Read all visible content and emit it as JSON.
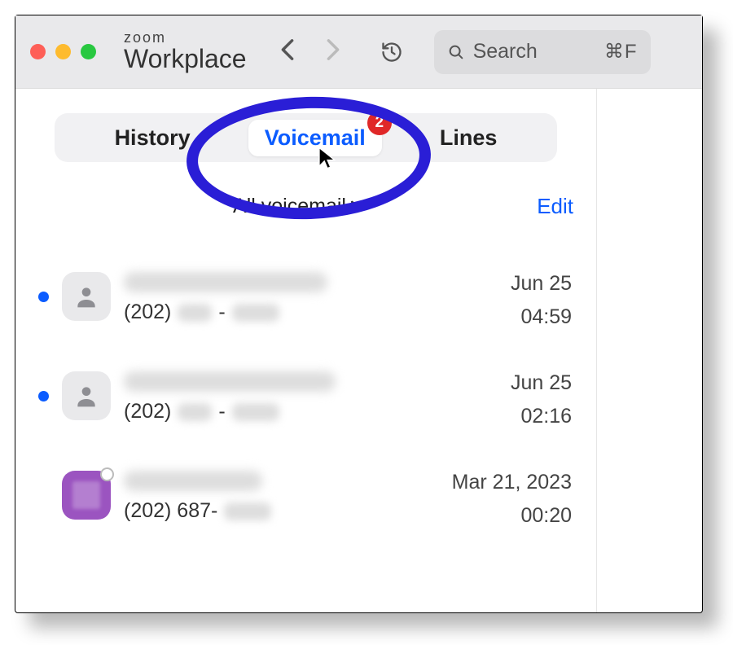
{
  "brand": {
    "line1": "zoom",
    "line2": "Workplace"
  },
  "search": {
    "placeholder": "Search",
    "shortcut": "⌘F"
  },
  "tabs": [
    {
      "label": "History",
      "active": false
    },
    {
      "label": "Voicemail",
      "active": true,
      "badge": "2"
    },
    {
      "label": "Lines",
      "active": false
    }
  ],
  "filter": {
    "label": "All voicemail",
    "edit": "Edit"
  },
  "voicemails": [
    {
      "unread": true,
      "avatar": "generic",
      "name_redacted": true,
      "name_blur_width": 250,
      "phone_prefix": "(202)",
      "phone_mid_redacted": true,
      "phone_last_redacted": true,
      "date": "Jun 25",
      "duration": "04:59"
    },
    {
      "unread": true,
      "avatar": "generic",
      "name_redacted": true,
      "name_blur_width": 260,
      "phone_prefix": "(202)",
      "phone_mid_redacted": true,
      "phone_last_redacted": true,
      "date": "Jun 25",
      "duration": "02:16"
    },
    {
      "unread": false,
      "avatar": "purple",
      "presence": "offline",
      "name_redacted": true,
      "name_blur_width": 170,
      "phone_prefix": "(202) 687-",
      "phone_last_redacted": true,
      "date": "Mar 21, 2023",
      "duration": "00:20"
    }
  ]
}
